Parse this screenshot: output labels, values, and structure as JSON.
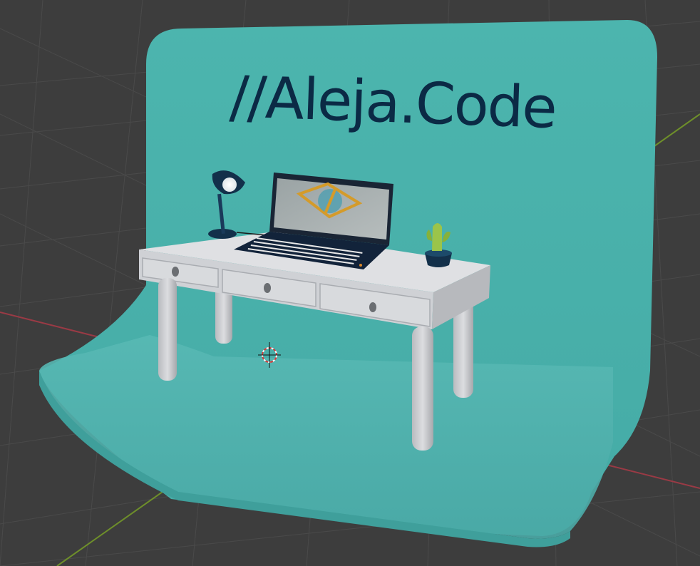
{
  "scene": {
    "backdrop_text": "//Aleja.Code",
    "objects": [
      "backdrop",
      "desk",
      "desk-lamp",
      "laptop",
      "cactus",
      "3d-cursor"
    ]
  },
  "colors": {
    "viewport_bg": "#3d3d3d",
    "grid": "#4a4a4a",
    "x_axis": "#9a3a45",
    "y_axis": "#6e8f2a",
    "backdrop": "#4bb3ad",
    "backdrop_floor": "#53b6b1",
    "text": "#0b2a45",
    "desk": "#d4d6da",
    "desk_shadow": "#a9acb1"
  }
}
